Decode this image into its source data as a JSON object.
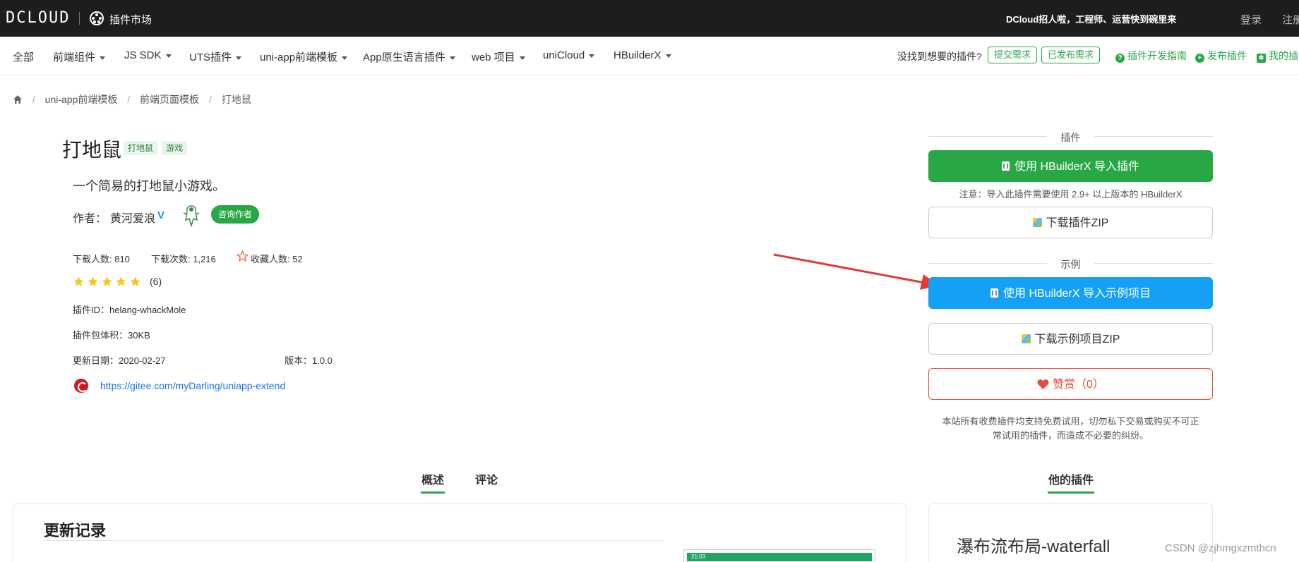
{
  "header": {
    "brand": "DCLOUD",
    "market": "插件市场",
    "recruit": "DCloud招人啦，工程师、运营快到碗里来",
    "login": "登录",
    "register": "注册"
  },
  "nav": {
    "items": [
      "全部",
      "前端组件",
      "JS SDK",
      "UTS插件",
      "uni-app前端模板",
      "App原生语言插件",
      "web 项目",
      "uniCloud",
      "HBuilderX"
    ],
    "prompt": "没找到想要的插件?",
    "submit_request": "提交需求",
    "published_requests": "已发布需求",
    "dev_guide": "插件开发指南",
    "publish_plugin": "发布插件",
    "my_plugins": "我的插"
  },
  "breadcrumb": {
    "items": [
      "uni-app前端模板",
      "前端页面模板",
      "打地鼠"
    ]
  },
  "plugin": {
    "title": "打地鼠",
    "tags": [
      "打地鼠",
      "游戏"
    ],
    "description": "一个简易的打地鼠小游戏。",
    "author_label": "作者：",
    "author_name": "黄河爱浪",
    "consult": "咨询作者",
    "downloads": "下载人数: 810",
    "download_count": "下载次数: 1,216",
    "favorites": "收藏人数: 52",
    "rating_stars": 5,
    "rating_count": "(6)",
    "plugin_id": "插件ID：helang-whackMole",
    "size": "插件包体积：30KB",
    "updated": "更新日期：2020-02-27",
    "version": "版本：1.0.0",
    "repo": "https://gitee.com/myDarling/uniapp-extend"
  },
  "sidebar": {
    "plugin_section": "插件",
    "import_plugin": "使用 HBuilderX 导入插件",
    "note": "注意：导入此插件需要使用 2.9+ 以上版本的 HBuilderX",
    "download_zip": "下载插件ZIP",
    "example_section": "示例",
    "import_example": "使用 HBuilderX 导入示例项目",
    "download_example_zip": "下载示例项目ZIP",
    "reward": "赞赏（0）",
    "disclaimer_line1": "本站所有收费插件均支持免费试用，切勿私下交易或购买不可正",
    "disclaimer_line2": "常试用的插件，而造成不必要的纠纷。"
  },
  "tabs": {
    "overview": "概述",
    "comments": "评论",
    "his_plugins": "他的插件"
  },
  "content": {
    "changelog_title": "更新记录",
    "preview_status": "21:03",
    "other_plugin_title": "瀑布流布局-waterfall"
  },
  "watermark": "CSDN @zjhmgxzmthcn",
  "colors": {
    "green": "#28a745",
    "blue": "#14a0f5",
    "danger": "#e74c3c",
    "topbar": "#1d1d1f"
  }
}
